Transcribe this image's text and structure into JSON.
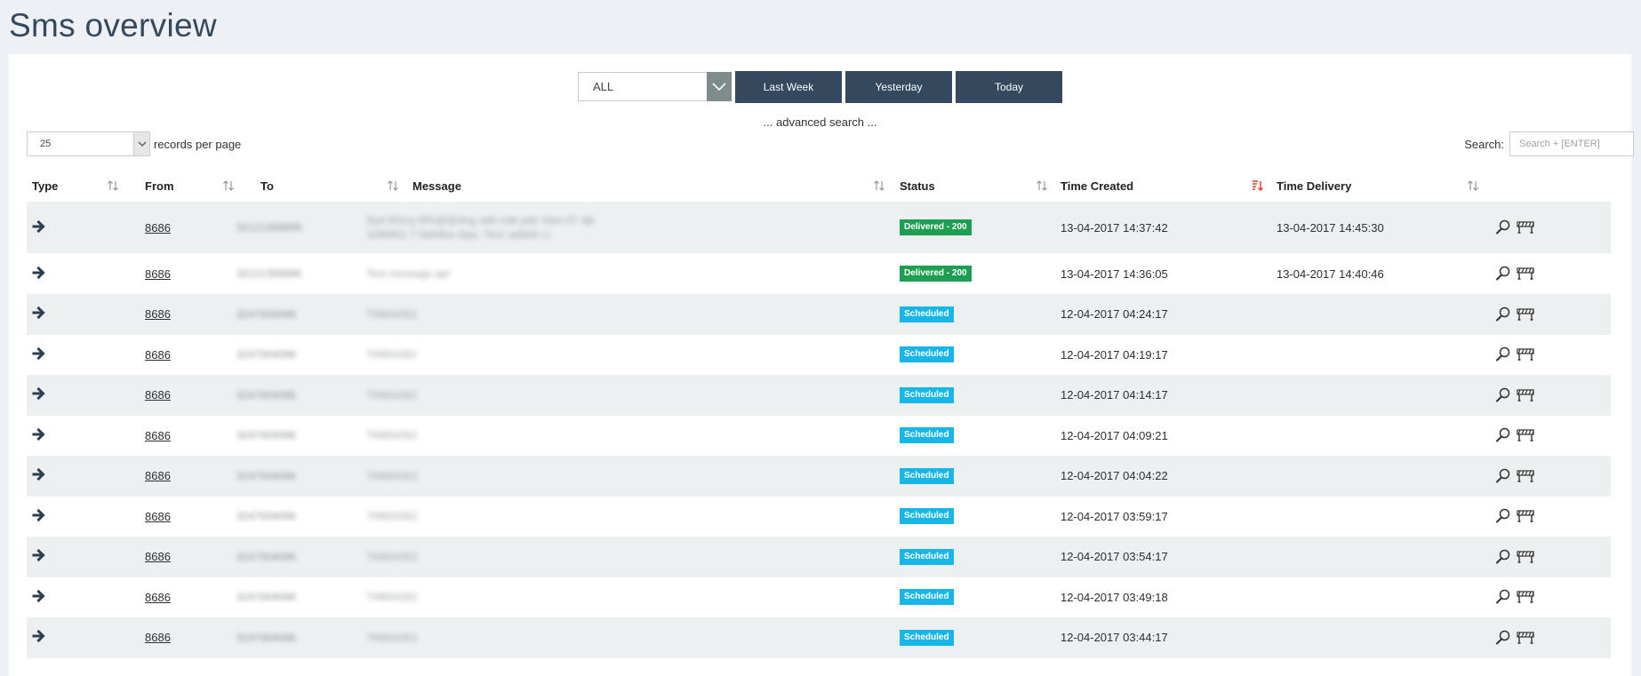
{
  "page": {
    "title": "Sms overview"
  },
  "filters": {
    "period_value": "ALL",
    "buttons": [
      "Last Week",
      "Yesterday",
      "Today"
    ],
    "advanced_search": "... advanced search ..."
  },
  "length": {
    "value": "25",
    "label": "records per page"
  },
  "search": {
    "label": "Search:",
    "placeholder": "Search + [ENTER]"
  },
  "table": {
    "columns": [
      "Type",
      "From",
      "To",
      "Message",
      "Status",
      "Time Created",
      "Time Delivery"
    ],
    "rows": [
      {
        "from": "8686",
        "to": "32121356895",
        "message": "Syd 001rq 0f%@@4ng with mtk pdn Vbm 07 4jk 1k99451 7 0d04ka rbps. Yk1r ad0d4 r,/",
        "status": "Delivered - 200",
        "status_type": "delivered",
        "created": "13-04-2017 14:37:42",
        "delivery": "13-04-2017 14:45:30"
      },
      {
        "from": "8686",
        "to": "32121356895",
        "message": "Test message apl",
        "status": "Delivered - 200",
        "status_type": "delivered",
        "created": "13-04-2017 14:36:05",
        "delivery": "13-04-2017 14:40:46"
      },
      {
        "from": "8686",
        "to": "3247004096",
        "message": "Tf4654352",
        "status": "Scheduled",
        "status_type": "scheduled",
        "created": "12-04-2017 04:24:17",
        "delivery": ""
      },
      {
        "from": "8686",
        "to": "3247004096",
        "message": "Tf4654352",
        "status": "Scheduled",
        "status_type": "scheduled",
        "created": "12-04-2017 04:19:17",
        "delivery": ""
      },
      {
        "from": "8686",
        "to": "3247004096",
        "message": "Tf4654352",
        "status": "Scheduled",
        "status_type": "scheduled",
        "created": "12-04-2017 04:14:17",
        "delivery": ""
      },
      {
        "from": "8686",
        "to": "3247004096",
        "message": "Tf4654352",
        "status": "Scheduled",
        "status_type": "scheduled",
        "created": "12-04-2017 04:09:21",
        "delivery": ""
      },
      {
        "from": "8686",
        "to": "3247004096",
        "message": "Tf4654352",
        "status": "Scheduled",
        "status_type": "scheduled",
        "created": "12-04-2017 04:04:22",
        "delivery": ""
      },
      {
        "from": "8686",
        "to": "3247004096",
        "message": "Tf4654352",
        "status": "Scheduled",
        "status_type": "scheduled",
        "created": "12-04-2017 03:59:17",
        "delivery": ""
      },
      {
        "from": "8686",
        "to": "3247004096",
        "message": "Tf4654352",
        "status": "Scheduled",
        "status_type": "scheduled",
        "created": "12-04-2017 03:54:17",
        "delivery": ""
      },
      {
        "from": "8686",
        "to": "3247004096",
        "message": "Tf4654352",
        "status": "Scheduled",
        "status_type": "scheduled",
        "created": "12-04-2017 03:49:18",
        "delivery": ""
      },
      {
        "from": "8686",
        "to": "3247004096",
        "message": "Tf4654352",
        "status": "Scheduled",
        "status_type": "scheduled",
        "created": "12-04-2017 03:44:17",
        "delivery": ""
      }
    ]
  },
  "icons": {
    "type": "arrow-right-icon",
    "view": "magnifier-icon",
    "archive": "barrier-icon",
    "sort": "sort-icon",
    "sort_active": "sort-desc-icon"
  },
  "colors": {
    "header_button": "#34495e",
    "delivered": "#1e9e52",
    "scheduled": "#17b6e6",
    "sort_active": "#e03b2b"
  }
}
